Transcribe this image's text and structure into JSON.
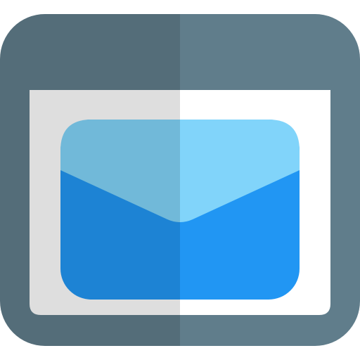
{
  "icon": {
    "name": "browser-mail-icon",
    "colors": {
      "frame_light": "#607D8B",
      "frame_dark": "#546D79",
      "window_light": "#FFFFFF",
      "window_dark": "#DEDEDE",
      "envelope_body_light": "#2196F3",
      "envelope_body_dark": "#1D83D4",
      "envelope_flap_light": "#81D4FA",
      "envelope_flap_dark": "#71B9D9"
    }
  }
}
